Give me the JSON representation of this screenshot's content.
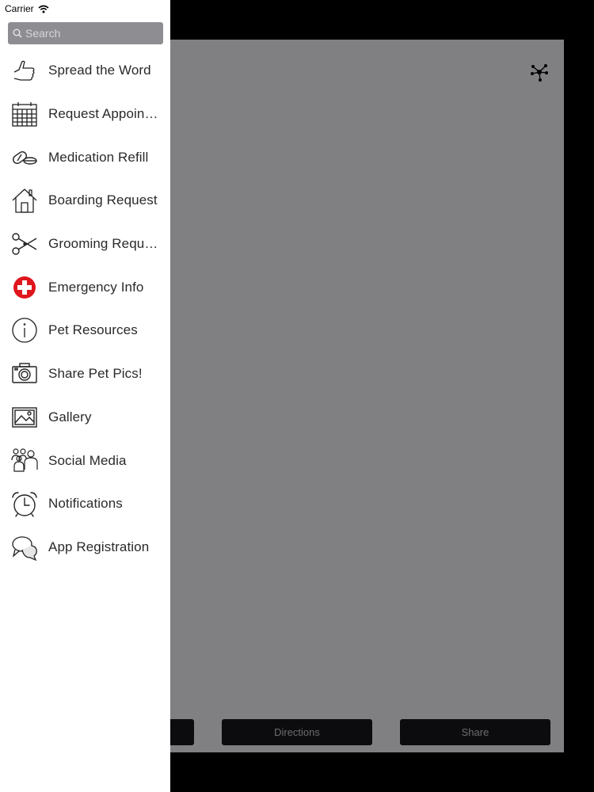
{
  "status_bar": {
    "carrier": "Carrier"
  },
  "search": {
    "placeholder": "Search"
  },
  "menu": {
    "items": [
      {
        "label": "Spread the Word",
        "icon": "thumbs-up-icon"
      },
      {
        "label": "Request Appointment",
        "icon": "calendar-icon"
      },
      {
        "label": "Medication Refill",
        "icon": "pills-icon"
      },
      {
        "label": "Boarding Request",
        "icon": "house-icon"
      },
      {
        "label": "Grooming Request",
        "icon": "scissors-icon"
      },
      {
        "label": "Emergency Info",
        "icon": "red-cross-icon"
      },
      {
        "label": "Pet Resources",
        "icon": "info-icon"
      },
      {
        "label": "Share Pet Pics!",
        "icon": "camera-icon"
      },
      {
        "label": "Gallery",
        "icon": "image-icon"
      },
      {
        "label": "Social Media",
        "icon": "people-icon"
      },
      {
        "label": "Notifications",
        "icon": "alarm-clock-icon"
      },
      {
        "label": "App Registration",
        "icon": "chat-bubbles-icon"
      }
    ]
  },
  "bottom_bar": {
    "directions_label": "Directions",
    "share_label": "Share"
  },
  "colors": {
    "panel": "#807f81",
    "drawer": "#ffffff",
    "emergency_red": "#e0161e",
    "search_bg": "#8e8e92"
  }
}
